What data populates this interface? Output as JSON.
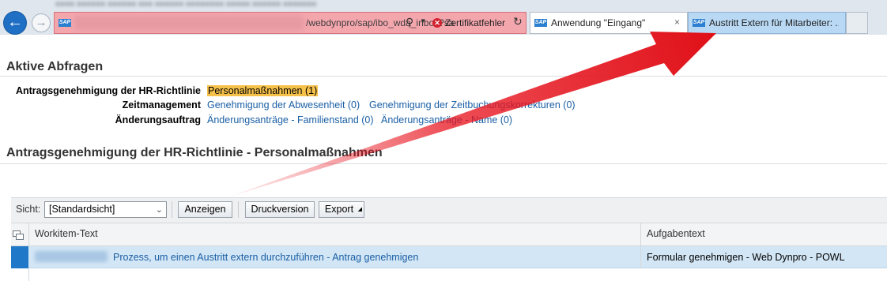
{
  "browser": {
    "url_visible": "/webdynpro/sap/ibo_wda_inbox?sa",
    "cert_error": "Zertifikatfehler",
    "tabs": [
      {
        "label": "Anwendung \"Eingang\"",
        "close": "×"
      },
      {
        "label": "Austritt Extern für Mitarbeiter: ..."
      }
    ],
    "logo_text": "SAP"
  },
  "page": {
    "section_active": "Aktive Abfragen",
    "queries": [
      {
        "label": "Antragsgenehmigung der HR-Richtlinie",
        "links": [
          "Personalmaßnahmen (1)"
        ]
      },
      {
        "label": "Zeitmanagement",
        "links": [
          "Genehmigung der Abwesenheit (0)",
          "Genehmigung der Zeitbuchungskorrekturen (0)"
        ]
      },
      {
        "label": "Änderungsauftrag",
        "links": [
          "Änderungsanträge - Familienstand (0)",
          "Änderungsanträge - Name (0)"
        ]
      }
    ],
    "section_list": "Antragsgenehmigung der HR-Richtlinie - Personalmaßnahmen"
  },
  "toolbar": {
    "view_label": "Sicht:",
    "view_value": "[Standardsicht]",
    "show_button": "Anzeigen",
    "print_button": "Druckversion",
    "export_button": "Export"
  },
  "table": {
    "headers": [
      "Workitem-Text",
      "Aufgabentext"
    ],
    "rows": [
      {
        "workitem": "Prozess, um einen Austritt extern durchzuführen - Antrag genehmigen",
        "task": "Formular genehmigen - Web Dynpro - POWL"
      }
    ]
  },
  "colors": {
    "accent_arrow": "#e8121d",
    "highlight": "#f6c14a",
    "link": "#1a5fa5",
    "selected_row": "#d3e6f5"
  }
}
